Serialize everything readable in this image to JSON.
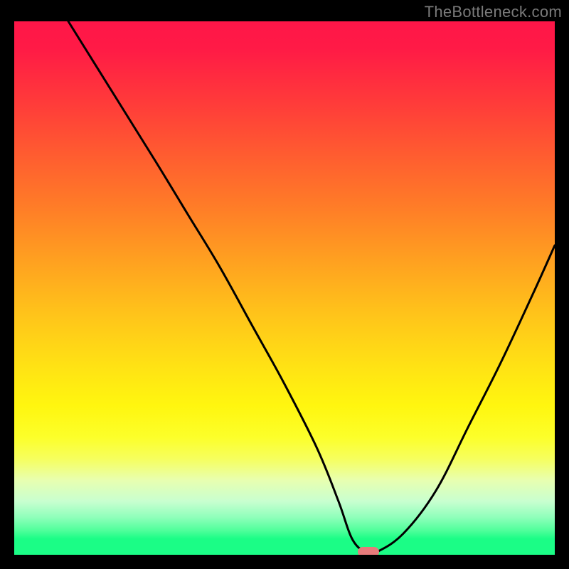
{
  "watermark": "TheBottleneck.com",
  "chart_data": {
    "type": "line",
    "title": "",
    "xlabel": "",
    "ylabel": "",
    "xlim": [
      0,
      100
    ],
    "ylim": [
      0,
      100
    ],
    "grid": false,
    "legend": "none",
    "series": [
      {
        "name": "bottleneck-curve",
        "x": [
          10,
          18,
          26,
          32,
          38,
          44,
          50,
          56,
          60,
          62.5,
          65,
          67,
          72,
          78,
          84,
          90,
          96,
          100
        ],
        "values": [
          100,
          87,
          74,
          64,
          54,
          43,
          32,
          20,
          10,
          3,
          0.5,
          0.5,
          4,
          12,
          24,
          36,
          49,
          58
        ]
      }
    ],
    "marker": {
      "name": "optimal-point",
      "x": 65.5,
      "y": 0.5,
      "color": "#e77b7b"
    },
    "background_gradient": {
      "top": "#ff1648",
      "mid": "#ffe314",
      "bottom": "#1bfd86"
    }
  }
}
